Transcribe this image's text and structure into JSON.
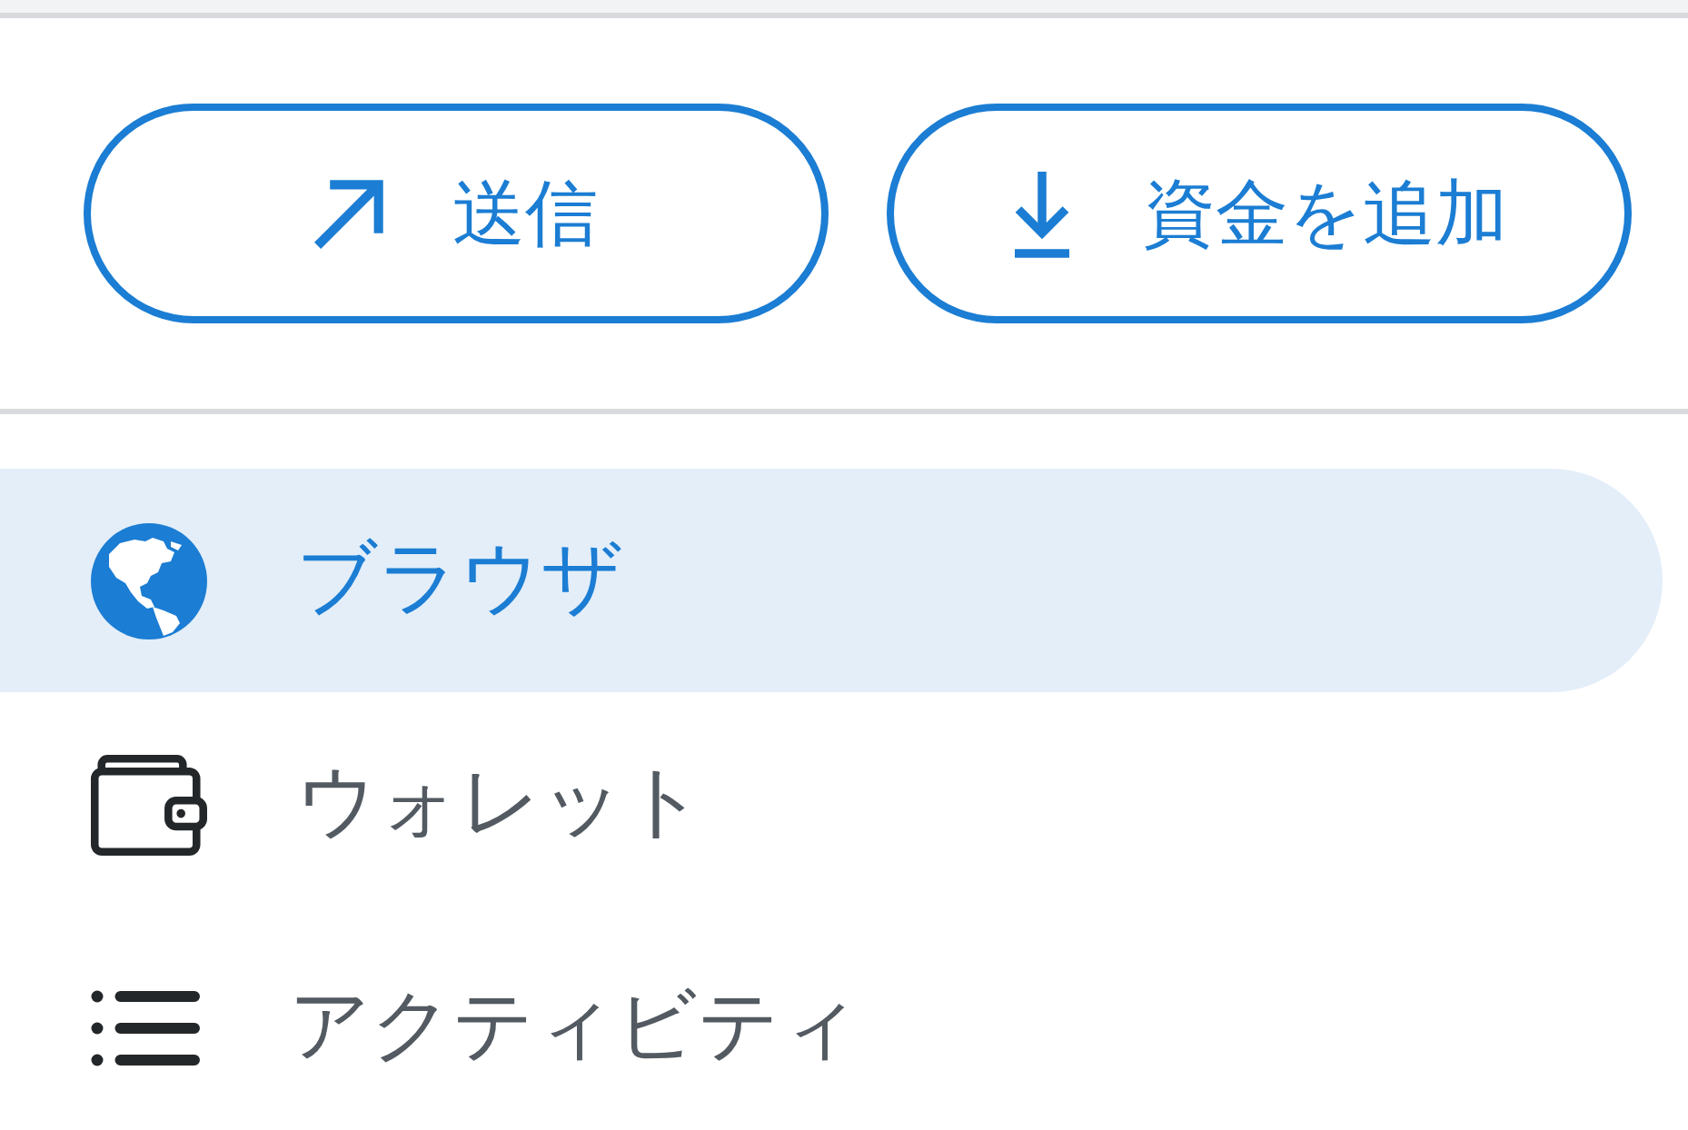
{
  "actions": [
    {
      "kind": "send",
      "label": "送信"
    },
    {
      "kind": "add_funds",
      "label": "資金を追加"
    }
  ],
  "menu": [
    {
      "kind": "globe",
      "label": "ブラウザ",
      "selected": true
    },
    {
      "kind": "wallet",
      "label": "ウォレット",
      "selected": false
    },
    {
      "kind": "list",
      "label": "アクティビティ",
      "selected": false
    }
  ]
}
